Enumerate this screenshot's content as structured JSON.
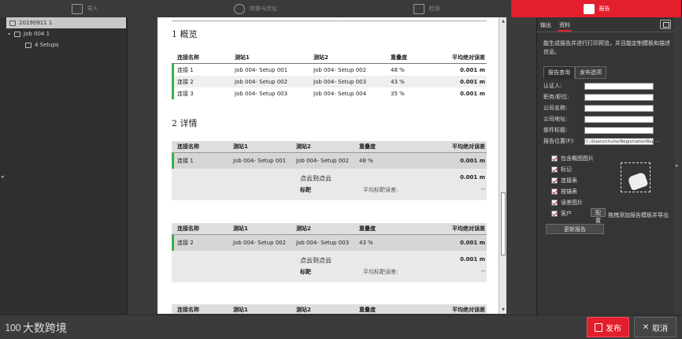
{
  "workflow": {
    "steps": [
      {
        "label": "导入",
        "icon": "import-icon"
      },
      {
        "label": "转换与优化",
        "icon": "globe-search-icon"
      },
      {
        "label": "检测",
        "icon": "check-icon"
      },
      {
        "label": "报告",
        "icon": "report-icon"
      }
    ],
    "active": 3
  },
  "tree": {
    "root": "20190911 1",
    "job": "Job 004 1",
    "setups": "4 Setups"
  },
  "report": {
    "overview_title": "1 概览",
    "overview_headers": [
      "连接名称",
      "测站1",
      "测站2",
      "重叠度",
      "平均绝对误差"
    ],
    "overview_rows": [
      [
        "连接 1",
        "Job 004- Setup 001",
        "Job 004- Setup 002",
        "48 %",
        "0.001 m"
      ],
      [
        "连接 2",
        "Job 004- Setup 002",
        "Job 004- Setup 003",
        "43 %",
        "0.001 m"
      ],
      [
        "连接 3",
        "Job 004- Setup 003",
        "Job 004- Setup 004",
        "35 %",
        "0.001 m"
      ]
    ],
    "detail_title": "2 详情",
    "detail_headers": [
      "连接名称",
      "测站1",
      "测站2",
      "重叠度",
      "平均绝对误差"
    ],
    "details": [
      {
        "row": [
          "连接 1",
          "Job 004- Setup 001",
          "Job 004- Setup 002",
          "48 %",
          "0.001 m"
        ],
        "cloud_label": "点云到点云",
        "cloud_value": "0.001 m",
        "target_label": "标靶",
        "target_err_label": "平均标靶误差:",
        "target_value": "--"
      },
      {
        "row": [
          "连接 2",
          "Job 004- Setup 002",
          "Job 004- Setup 003",
          "43 %",
          "0.001 m"
        ],
        "cloud_label": "点云到点云",
        "cloud_value": "0.001 m",
        "target_label": "标靶",
        "target_err_label": "平均标靶误差:",
        "target_value": "--"
      }
    ],
    "third_headers": [
      "连接名称",
      "测站1",
      "测站2",
      "重叠度",
      "平均绝对误差"
    ]
  },
  "panel": {
    "tabs": [
      "输出",
      "资料"
    ],
    "description": "能生成报告并进行打印预览，并且能定制模板和描述信息。",
    "subtabs": [
      "报告查询",
      "发布选项"
    ],
    "fields": [
      {
        "label": "认证人:",
        "value": ""
      },
      {
        "label": "职务/职位:",
        "value": ""
      },
      {
        "label": "公司名称:",
        "value": ""
      },
      {
        "label": "公司地址:",
        "value": ""
      },
      {
        "label": "部件标题:",
        "value": ""
      },
      {
        "label": "报告位置(F):",
        "value": "C:/Users/chuhe/RegistrationReport.pdf"
      }
    ],
    "checkboxes": [
      "包含概图图片",
      "标记",
      "连接表",
      "按锚表",
      "误差图片",
      "客户"
    ],
    "config_label": "配置",
    "drop_text": "拖拽添加报告模板并导出",
    "update_label": "更新报告"
  },
  "footer": {
    "logo_mark": "100",
    "logo_text": "大数跨境",
    "publish": "发布",
    "cancel": "取消"
  }
}
